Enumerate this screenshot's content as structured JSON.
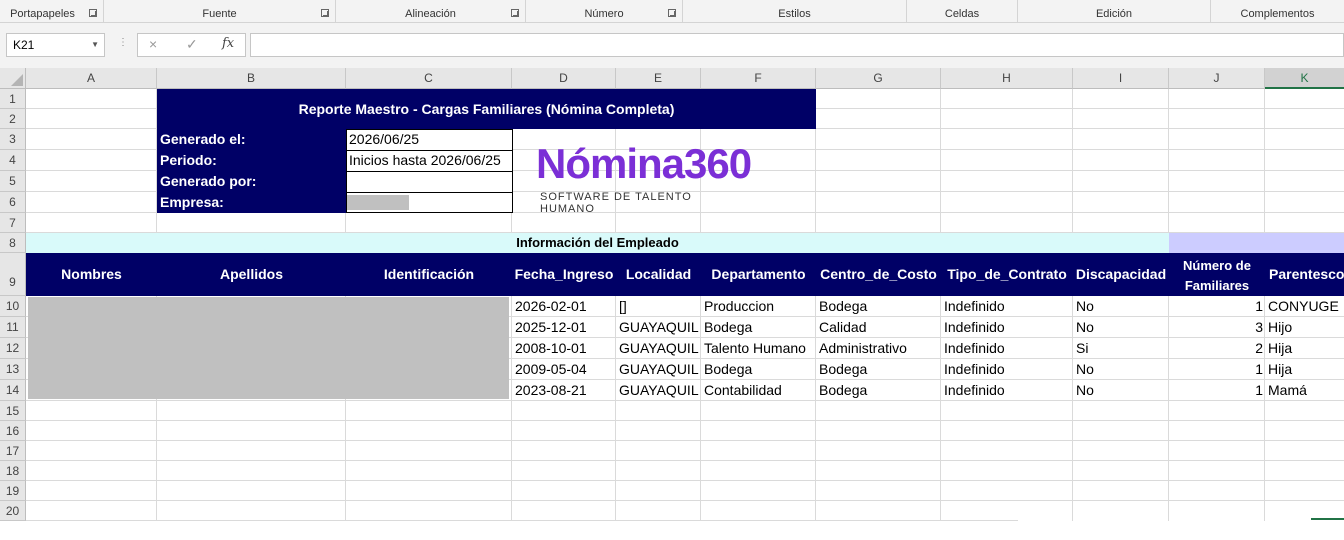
{
  "ribbon": {
    "groups": [
      {
        "label": "Portapapeles"
      },
      {
        "label": "Fuente"
      },
      {
        "label": "Alineación"
      },
      {
        "label": "Número"
      },
      {
        "label": "Estilos"
      },
      {
        "label": "Celdas"
      },
      {
        "label": "Edición"
      },
      {
        "label": "Complementos"
      }
    ]
  },
  "formula_bar": {
    "name_box": "K21",
    "formula": "",
    "cancel_icon": "×",
    "enter_icon": "✓",
    "fx_icon": "fx"
  },
  "columns": [
    "A",
    "B",
    "C",
    "D",
    "E",
    "F",
    "G",
    "H",
    "I",
    "J",
    "K"
  ],
  "rows": [
    "1",
    "2",
    "3",
    "4",
    "5",
    "6",
    "7",
    "8",
    "9",
    "10",
    "11",
    "12",
    "13",
    "14",
    "15",
    "16",
    "17",
    "18",
    "19",
    "20"
  ],
  "report": {
    "title": "Reporte Maestro - Cargas Familiares (Nómina Completa)",
    "fields": [
      {
        "label": "Generado el:",
        "value": "2026/06/25"
      },
      {
        "label": "Periodo:",
        "value": "Inicios hasta 2026/06/25"
      },
      {
        "label": "Generado por:",
        "value": ""
      },
      {
        "label": "Empresa:",
        "value": ""
      }
    ],
    "section_title": "Información del Empleado"
  },
  "logo": {
    "word": "Nómina360",
    "subtitle": "SOFTWARE DE TALENTO HUMANO",
    "color": "#7b2fd6"
  },
  "table": {
    "headers": [
      "Nombres",
      "Apellidos",
      "Identificación",
      "Fecha_Ingreso",
      "Localidad",
      "Departamento",
      "Centro_de_Costo",
      "Tipo_de_Contrato",
      "Discapacidad",
      "Número de Familiares",
      "Parentesco"
    ],
    "rows": [
      {
        "fecha": "2026-02-01",
        "localidad": "[]",
        "departamento": "Produccion",
        "centro": "Bodega",
        "contrato": "Indefinido",
        "discapacidad": "No",
        "familiares": "1",
        "parentesco": "CONYUGE"
      },
      {
        "fecha": "2025-12-01",
        "localidad": "GUAYAQUIL",
        "departamento": "Bodega",
        "centro": "Calidad",
        "contrato": "Indefinido",
        "discapacidad": "No",
        "familiares": "3",
        "parentesco": "Hijo"
      },
      {
        "fecha": "2008-10-01",
        "localidad": "GUAYAQUIL",
        "departamento": "Talento Humano",
        "centro": "Administrativo",
        "contrato": "Indefinido",
        "discapacidad": "Si",
        "familiares": "2",
        "parentesco": "Hija"
      },
      {
        "fecha": "2009-05-04",
        "localidad": "GUAYAQUIL",
        "departamento": "Bodega",
        "centro": "Bodega",
        "contrato": "Indefinido",
        "discapacidad": "No",
        "familiares": "1",
        "parentesco": "Hija"
      },
      {
        "fecha": "2023-08-21",
        "localidad": "GUAYAQUIL",
        "departamento": "Contabilidad",
        "centro": "Bodega",
        "contrato": "Indefinido",
        "discapacidad": "No",
        "familiares": "1",
        "parentesco": "Mamá"
      }
    ]
  },
  "colors": {
    "navy": "#000066",
    "light_cyan": "#d9fafa",
    "lavender": "#ccccff",
    "redacted": "#c0c0c0",
    "excel_green": "#217346"
  }
}
